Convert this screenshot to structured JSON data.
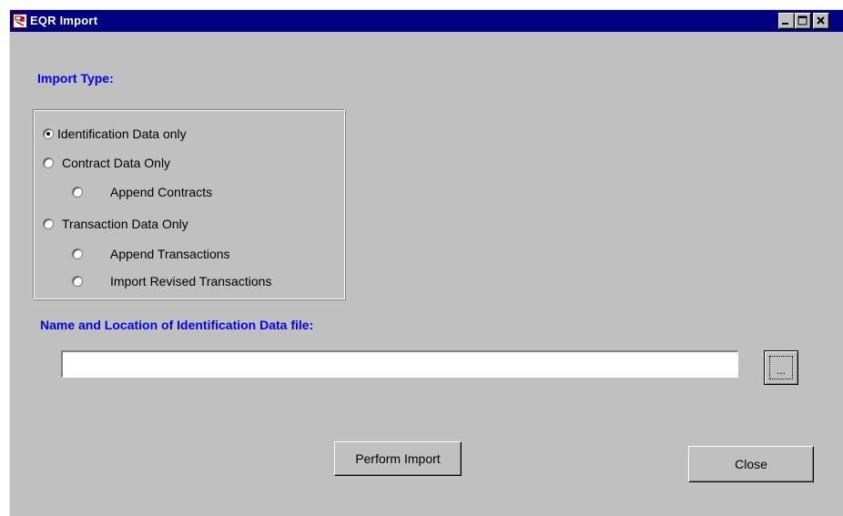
{
  "window": {
    "title": "EQR Import",
    "controls": {
      "minimize": "_",
      "maximize": "□",
      "close": "X"
    }
  },
  "import_type": {
    "heading": "Import Type:",
    "options": [
      {
        "label": "Identification Data only",
        "selected": true
      },
      {
        "label": "Contract Data Only",
        "selected": false
      },
      {
        "label": "Append Contracts",
        "selected": false
      },
      {
        "label": "Transaction Data Only",
        "selected": false
      },
      {
        "label": "Append Transactions",
        "selected": false
      },
      {
        "label": "Import Revised Transactions",
        "selected": false
      }
    ]
  },
  "file": {
    "heading": "Name and Location of Identification Data file:",
    "value": "",
    "browse_label": "..."
  },
  "buttons": {
    "perform_import": "Perform Import",
    "close": "Close"
  },
  "colors": {
    "title_bar": "#000080",
    "label_blue": "#0000ff",
    "window_bg": "#c0c0c0"
  }
}
